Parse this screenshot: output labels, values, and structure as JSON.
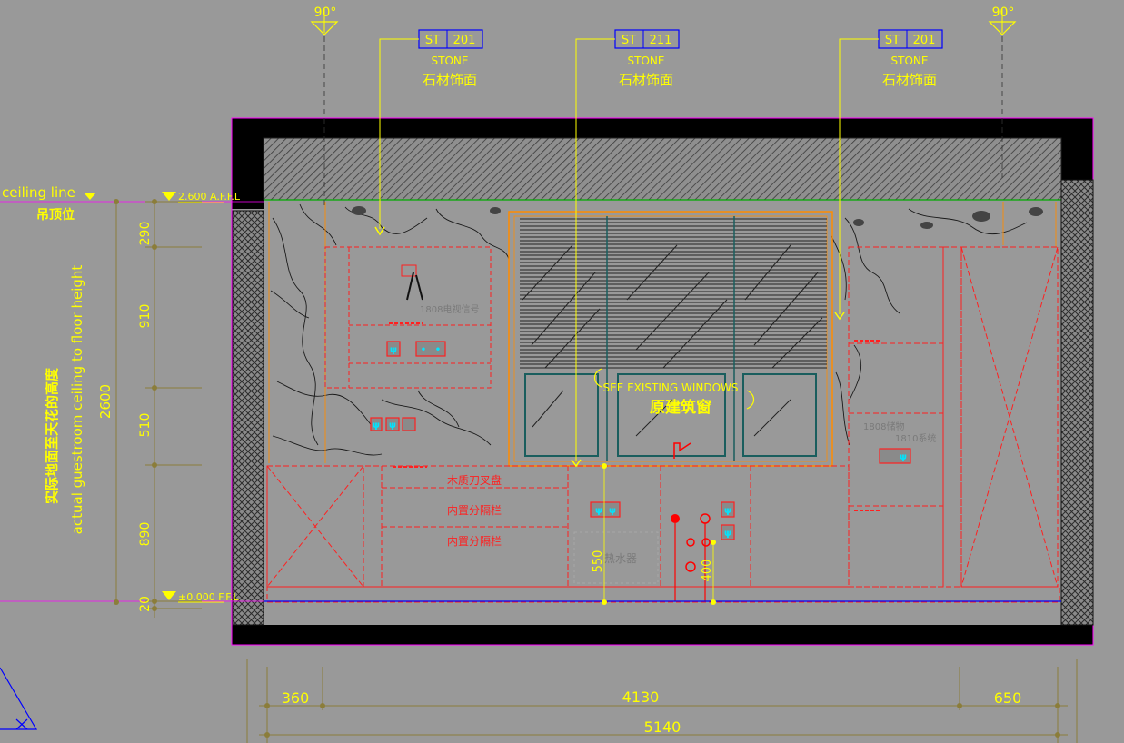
{
  "colors": {
    "background": "#999999",
    "wall_fill": "#000000",
    "annotation": "#ffff00",
    "tag_border": "#0000ff",
    "redline": "#ff0000",
    "dimension": "#8b7d3a",
    "window_frame": "#ff8c00",
    "ceiling_line": "#00aa00",
    "floor_line": "#0000ff",
    "axis_line": "#ff00ff",
    "green_bubble": "#00aa00"
  },
  "section_marks": [
    {
      "angle": "90°"
    },
    {
      "angle": "90°"
    }
  ],
  "material_tags": [
    {
      "code": "ST",
      "number": "201",
      "en": "STONE",
      "cn": "石材饰面"
    },
    {
      "code": "ST",
      "number": "211",
      "en": "STONE",
      "cn": "石材饰面"
    },
    {
      "code": "ST",
      "number": "201",
      "en": "STONE",
      "cn": "石材饰面"
    }
  ],
  "levels": {
    "ceiling_line_label": "ceiling line",
    "ceiling_cn": "吊顶位",
    "ceiling_level": "2.600 A.F.F.L",
    "floor_level": "±0.000 F.F.L"
  },
  "height_title": {
    "cn": "实际地面至天花的高度",
    "en": "actual guestroom ceiling to floor height"
  },
  "vertical_dims": {
    "total": "2600",
    "segments": [
      "290",
      "910",
      "510",
      "890",
      "20"
    ]
  },
  "horizontal_dims": {
    "segments": [
      "360",
      "4130",
      "650"
    ],
    "total": "5140"
  },
  "window_note": {
    "en": "SEE EXISTING WINDOWS",
    "cn": "原建筑窗"
  },
  "cabinet_labels": [
    "木质刀叉盘",
    "内置分隔栏",
    "内置分隔栏"
  ],
  "cabinet_dims": [
    "550",
    "400"
  ],
  "faint_labels": [
    "1808电视信号",
    "1808储物",
    "1810系统",
    "热水器"
  ]
}
